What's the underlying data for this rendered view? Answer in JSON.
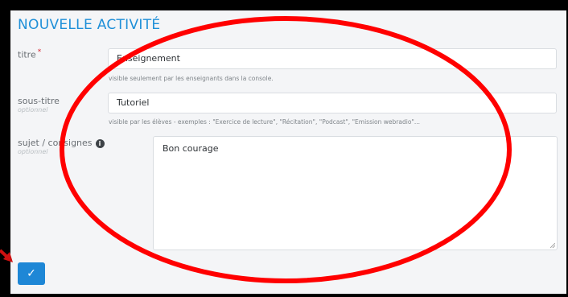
{
  "form": {
    "title": "NOUVELLE ACTIVITÉ",
    "titre_label": "titre",
    "titre_required": "*",
    "titre_value": "Enseignement",
    "titre_help": "visible seulement par les enseignants dans la console.",
    "soustitre_label": "sous-titre",
    "soustitre_optional": "optionnel",
    "soustitre_value": "Tutoriel",
    "soustitre_help": "visible par les élèves - exemples : \"Exercice de lecture\", \"Récitation\", \"Podcast\", \"Emission webradio\"...",
    "sujet_label": "sujet / consignes",
    "sujet_optional": "optionnel",
    "sujet_info_icon": "i",
    "sujet_value": "Bon courage",
    "submit_icon": "✓"
  },
  "annotation": {
    "ellipse_color": "#ff0000",
    "arrow_color": "#cc1111"
  }
}
